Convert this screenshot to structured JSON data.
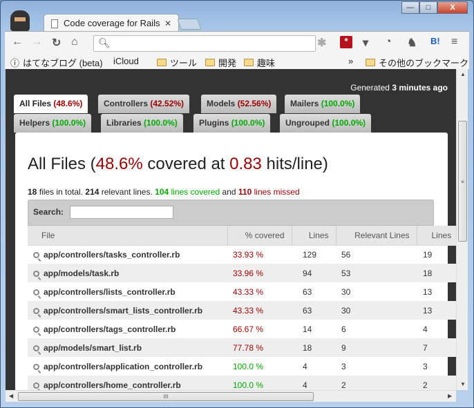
{
  "browser": {
    "tab_title": "Code coverage for Rails",
    "omnibox_value": "",
    "bookmarks": [
      {
        "label": "はてなブログ (beta)",
        "icon": "hatena-icon"
      },
      {
        "label": "iCloud",
        "icon": "apple-icon"
      },
      {
        "label": "ツール",
        "icon": "folder-icon"
      },
      {
        "label": "開発",
        "icon": "folder-icon"
      },
      {
        "label": "趣味",
        "icon": "folder-icon"
      }
    ],
    "overflow": "»",
    "other_bookmarks": "その他のブックマーク"
  },
  "generated": {
    "prefix": "Generated",
    "time": "3 minutes ago"
  },
  "tabs": [
    {
      "name": "All Files",
      "pct": "(48.6%)",
      "status": "red",
      "active": true
    },
    {
      "name": "Controllers",
      "pct": "(42.52%)",
      "status": "red"
    },
    {
      "name": "Models",
      "pct": "(52.56%)",
      "status": "red"
    },
    {
      "name": "Mailers",
      "pct": "(100.0%)",
      "status": "green"
    },
    {
      "name": "Helpers",
      "pct": "(100.0%)",
      "status": "green"
    },
    {
      "name": "Libraries",
      "pct": "(100.0%)",
      "status": "green"
    },
    {
      "name": "Plugins",
      "pct": "(100.0%)",
      "status": "green"
    },
    {
      "name": "Ungrouped",
      "pct": "(100.0%)",
      "status": "green"
    }
  ],
  "heading": {
    "a": "All Files (",
    "pct": "48.6%",
    "b": " covered at ",
    "hits": "0.83",
    "c": " hits/line)"
  },
  "summary": {
    "files": "18",
    "t1": " files in total. ",
    "relevant": "214",
    "t2": " relevant lines. ",
    "covered": "104",
    "t3": " lines covered",
    "t4": " and ",
    "missed": "110",
    "t5": " lines missed"
  },
  "search": {
    "label": "Search:",
    "value": ""
  },
  "table": {
    "headers": [
      "File",
      "% covered",
      "Lines",
      "Relevant Lines",
      "Lines"
    ],
    "rows": [
      [
        "app/controllers/tasks_controller.rb",
        "33.93 %",
        "129",
        "56",
        "19",
        "red"
      ],
      [
        "app/models/task.rb",
        "33.96 %",
        "94",
        "53",
        "18",
        "red"
      ],
      [
        "app/controllers/lists_controller.rb",
        "43.33 %",
        "63",
        "30",
        "13",
        "red"
      ],
      [
        "app/controllers/smart_lists_controller.rb",
        "43.33 %",
        "63",
        "30",
        "13",
        "red"
      ],
      [
        "app/controllers/tags_controller.rb",
        "66.67 %",
        "14",
        "6",
        "4",
        "red"
      ],
      [
        "app/models/smart_list.rb",
        "77.78 %",
        "18",
        "9",
        "7",
        "red"
      ],
      [
        "app/controllers/application_controller.rb",
        "100.0 %",
        "4",
        "3",
        "3",
        "green"
      ],
      [
        "app/controllers/home_controller.rb",
        "100.0 %",
        "4",
        "2",
        "2",
        "green"
      ]
    ]
  },
  "colors": {
    "red": "#990000",
    "green": "#00aa00",
    "background": "#333333"
  }
}
